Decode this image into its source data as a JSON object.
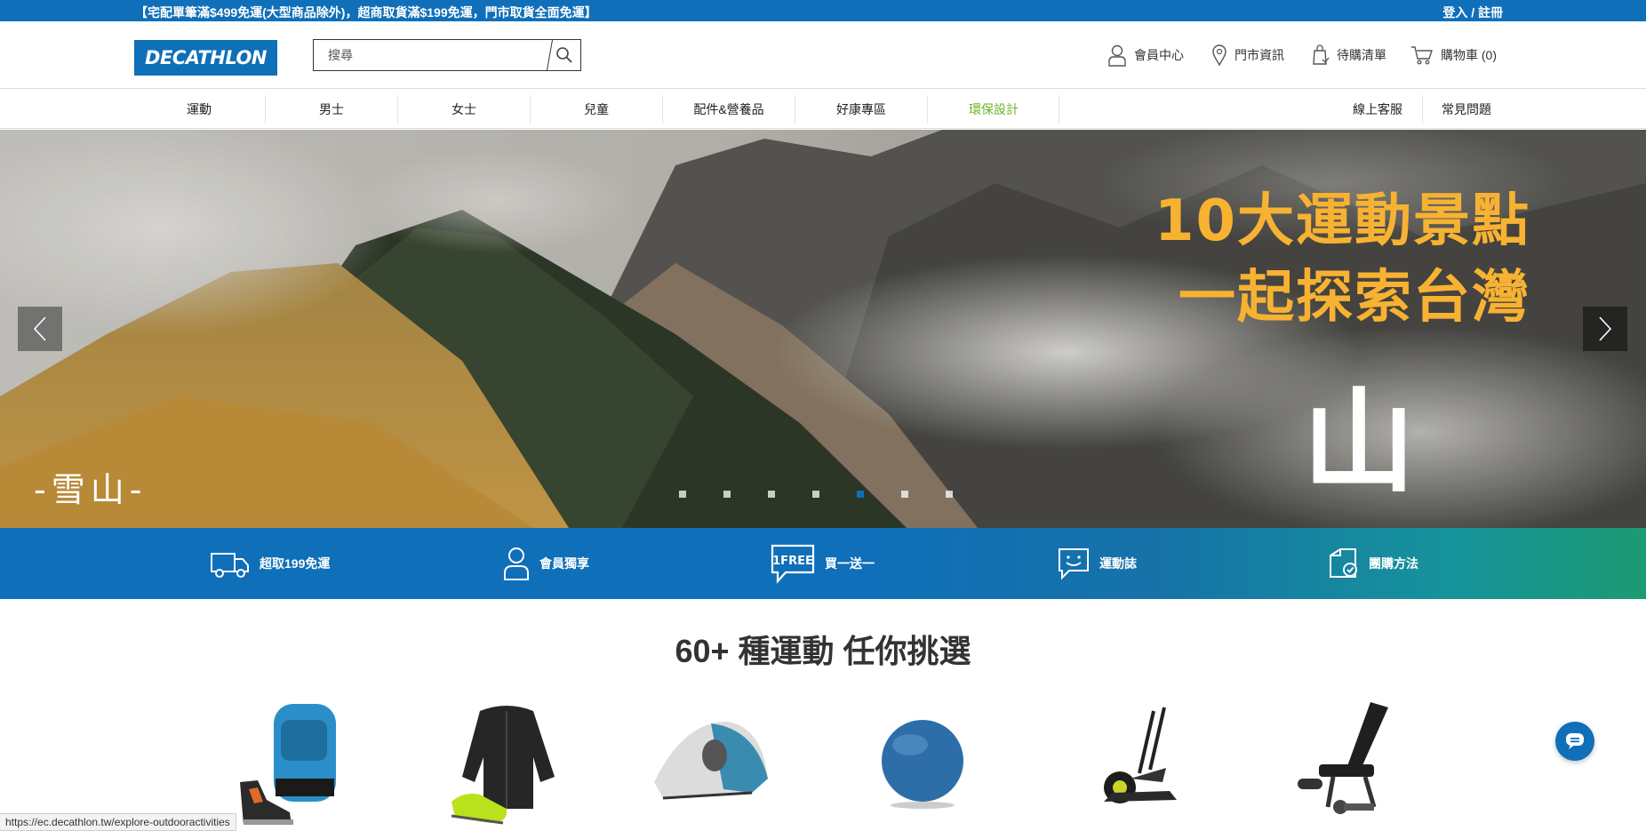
{
  "promo_bar": {
    "message": "【宅配單筆滿$499免運(大型商品除外)，超商取貨滿$199免運，門市取貨全面免運】",
    "login": "登入 / 註冊"
  },
  "header": {
    "logo": "DECATHLON",
    "search_placeholder": "搜尋",
    "links": {
      "member": "會員中心",
      "stores": "門市資訊",
      "wishlist": "待購清單",
      "cart": "購物車 (0)"
    }
  },
  "nav": {
    "items": [
      "運動",
      "男士",
      "女士",
      "兒童",
      "配件&營養品",
      "好康專區",
      "環保設計"
    ],
    "right": [
      "線上客服",
      "常見問題"
    ],
    "eco_color": "#6bb52a"
  },
  "hero": {
    "headline_line1": "10大運動景點",
    "headline_line2": "一起探索台灣",
    "big_char": "山",
    "place": "-雪山-",
    "slide_count": 7,
    "active_slide": 5
  },
  "features": [
    "超取199免運",
    "會員獨享",
    "買一送一",
    "運動誌",
    "團購方法"
  ],
  "features_icon_text": "1FREE",
  "section": {
    "title": "60+ 種運動 任你挑選"
  },
  "products": [
    "backpack-boots-icon",
    "jacket-shoes-icon",
    "tent-icon",
    "gym-ball-icon",
    "elliptical-icon",
    "weight-bench-icon"
  ],
  "status_url": "https://ec.decathlon.tw/explore-outdooractivities",
  "colors": {
    "brand_blue": "#0f6fb9",
    "headline_yellow": "#f8b232",
    "eco_green": "#6bb52a"
  }
}
